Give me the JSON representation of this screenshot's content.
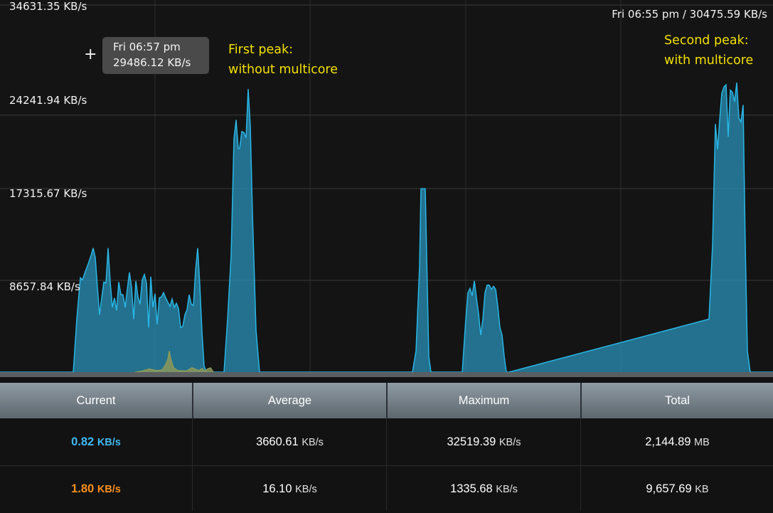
{
  "chart_data": {
    "type": "area",
    "ylim": [
      0,
      34631.35
    ],
    "unit": "KB/s",
    "y_tick_labels": [
      "34631.35 KB/s",
      "24241.94 KB/s",
      "17315.67 KB/s",
      "8657.84 KB/s"
    ],
    "series": [
      {
        "color": "#29b6e6",
        "x": [
          0,
          103,
          108,
          113,
          116,
          120,
          124,
          128,
          131,
          134,
          137,
          140,
          143,
          146,
          149,
          152,
          155,
          158,
          161,
          164,
          167,
          170,
          173,
          176,
          179,
          182,
          185,
          188,
          191,
          194,
          197,
          200,
          203,
          206,
          209,
          212,
          215,
          218,
          221,
          224,
          227,
          230,
          233,
          236,
          239,
          242,
          245,
          248,
          251,
          254,
          257,
          260,
          263,
          266,
          269,
          272,
          275,
          278,
          281,
          284,
          287,
          290,
          315,
          320,
          325,
          329,
          332,
          335,
          337,
          340,
          343,
          346,
          349,
          352,
          355,
          360,
          365,
          580,
          585,
          590,
          592,
          595,
          598,
          600,
          603,
          606,
          650,
          655,
          658,
          661,
          664,
          667,
          670,
          673,
          676,
          679,
          682,
          685,
          688,
          691,
          694,
          697,
          700,
          703,
          706,
          709,
          712,
          716,
          997,
          1002,
          1006,
          1009,
          1012,
          1015,
          1018,
          1021,
          1024,
          1027,
          1030,
          1033,
          1036,
          1039,
          1042,
          1045,
          1048,
          1051,
          1055,
          1087
        ],
        "values": [
          0,
          0,
          5000,
          8900,
          8700,
          9500,
          10200,
          11000,
          11700,
          10800,
          8000,
          5400,
          7000,
          8500,
          8400,
          11700,
          8500,
          6100,
          7000,
          5800,
          8500,
          7300,
          7300,
          6100,
          7800,
          9400,
          8000,
          5000,
          8600,
          7100,
          6400,
          8700,
          9200,
          8400,
          4200,
          9000,
          6100,
          7400,
          4500,
          7000,
          7100,
          7500,
          7000,
          6600,
          6200,
          6900,
          6100,
          6500,
          6000,
          4200,
          4300,
          5400,
          5900,
          7300,
          6400,
          6300,
          9600,
          11700,
          8200,
          3800,
          600,
          0,
          0,
          5000,
          11000,
          22000,
          23800,
          21100,
          21100,
          22700,
          22600,
          22100,
          26700,
          23200,
          15000,
          4000,
          0,
          0,
          2000,
          10000,
          17300,
          17300,
          17300,
          11000,
          1500,
          0,
          0,
          5000,
          7500,
          7900,
          7200,
          8600,
          7000,
          5500,
          3500,
          5000,
          7500,
          8200,
          8200,
          7800,
          8100,
          7800,
          6200,
          4200,
          3500,
          1500,
          0,
          0,
          5000,
          12000,
          23400,
          21000,
          23800,
          26300,
          26900,
          27100,
          22200,
          26600,
          26400,
          25500,
          27300,
          24000,
          23600,
          25200,
          12000,
          2000,
          0,
          0
        ]
      },
      {
        "color": "#8a9a5b",
        "x": [
          190,
          200,
          210,
          220,
          228,
          232,
          236,
          238,
          240,
          244,
          250,
          262,
          270,
          276,
          280,
          284,
          288,
          292,
          296,
          300
        ],
        "values": [
          0,
          100,
          300,
          150,
          200,
          600,
          1200,
          2000,
          1300,
          400,
          150,
          100,
          400,
          250,
          150,
          350,
          100,
          300,
          400,
          0
        ]
      }
    ],
    "annotations": [
      "First peak:\nwithout multicore",
      "Second peak:\nwith multicore"
    ],
    "tooltip": {
      "line1": "Fri 06:57 pm",
      "line2": "29486.12 KB/s"
    },
    "corner_readout": "Fri 06:55 pm / 30475.59 KB/s"
  },
  "chart": {
    "annotation1_line1": "First peak:",
    "annotation1_line2": "without multicore",
    "annotation2_line1": "Second peak:",
    "annotation2_line2": "with multicore"
  },
  "colors": {
    "series1": "#29b6e6",
    "series2": "#8a9a5b",
    "current_blue": "#3fb8f0",
    "current_orange": "#f7901e"
  },
  "stats": {
    "headers": [
      "Current",
      "Average",
      "Maximum",
      "Total"
    ],
    "rows": [
      {
        "current": "0.82",
        "current_unit": "KB/s",
        "average": "3660.61",
        "average_unit": "KB/s",
        "maximum": "32519.39",
        "maximum_unit": "KB/s",
        "total": "2,144.89",
        "total_unit": "MB"
      },
      {
        "current": "1.80",
        "current_unit": "KB/s",
        "average": "16.10",
        "average_unit": "KB/s",
        "maximum": "1335.68",
        "maximum_unit": "KB/s",
        "total": "9,657.69",
        "total_unit": "KB"
      }
    ]
  }
}
